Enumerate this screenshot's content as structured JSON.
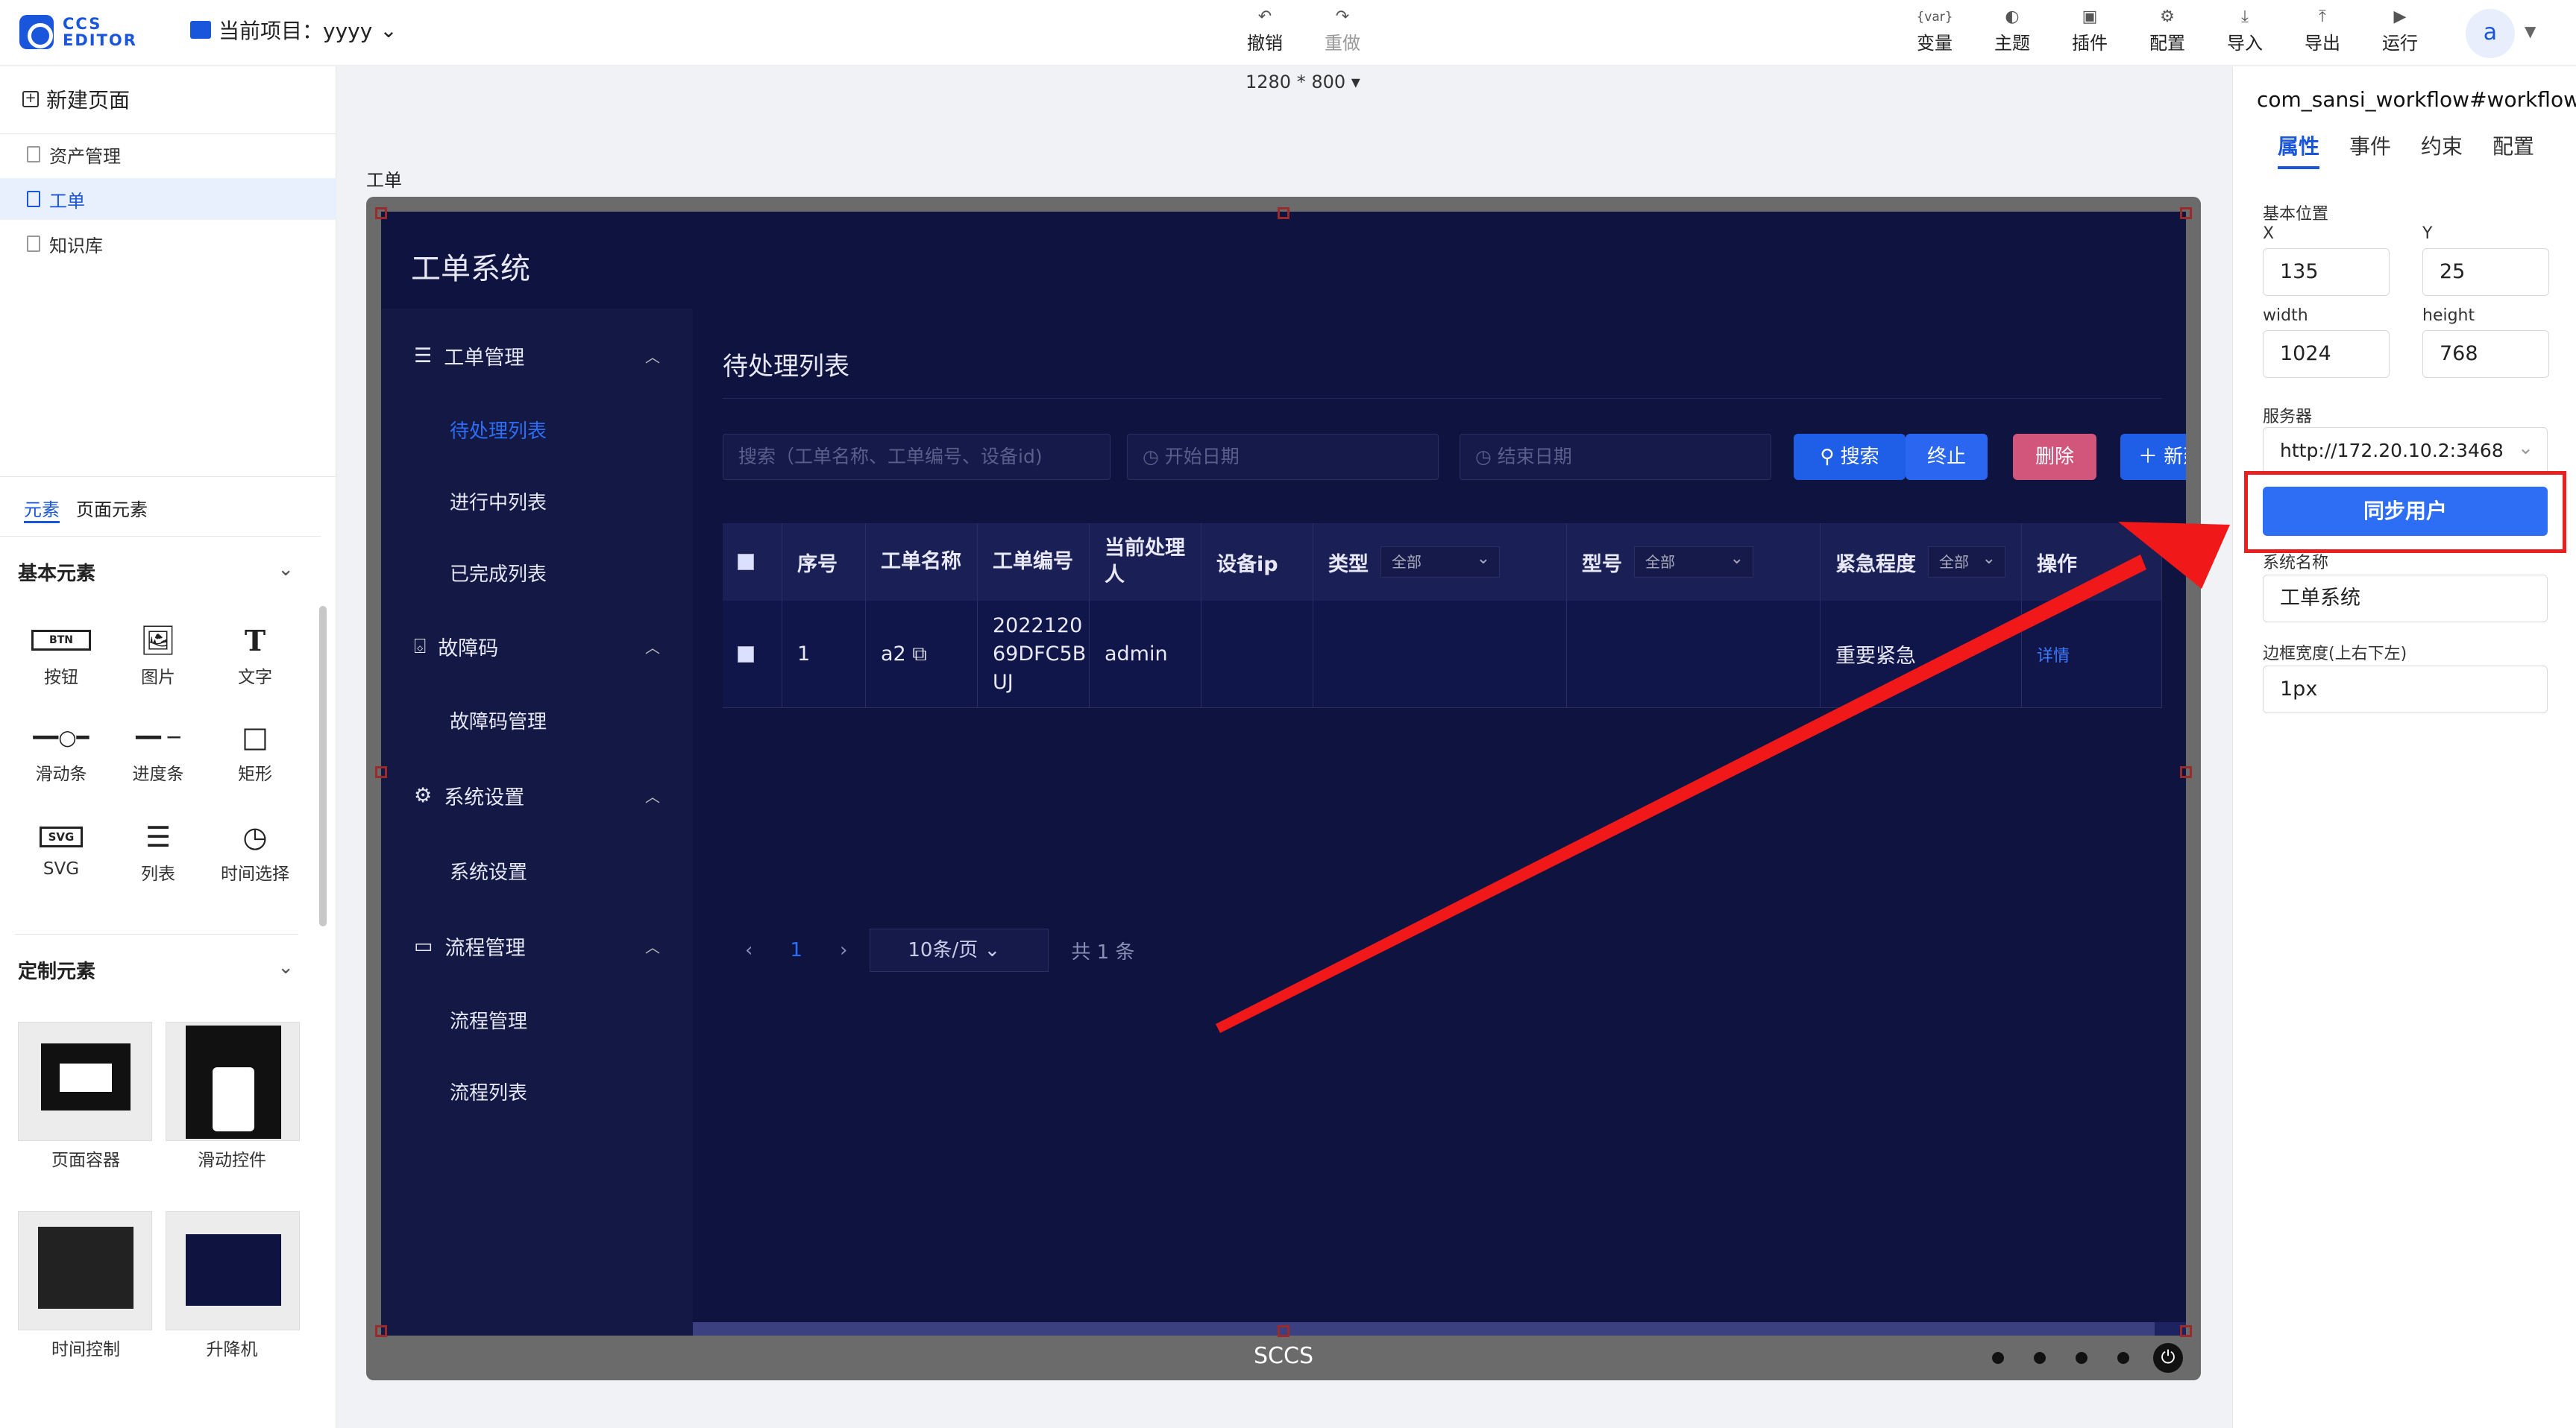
{
  "topbar": {
    "logo_line1": "CCS",
    "logo_line2": "EDITOR",
    "project_label": "当前项目：yyyy",
    "tools": [
      {
        "icon": "undo-icon",
        "label": "撤销"
      },
      {
        "icon": "redo-icon",
        "label": "重做"
      },
      {
        "icon": "variable-icon",
        "label": "变量"
      },
      {
        "icon": "theme-icon",
        "label": "主题"
      },
      {
        "icon": "plugin-icon",
        "label": "插件"
      },
      {
        "icon": "config-icon",
        "label": "配置"
      },
      {
        "icon": "import-icon",
        "label": "导入"
      },
      {
        "icon": "export-icon",
        "label": "导出"
      },
      {
        "icon": "run-icon",
        "label": "运行"
      }
    ],
    "avatar": "a"
  },
  "left": {
    "new_page": "新建页面",
    "pages": [
      "资产管理",
      "工单",
      "知识库"
    ],
    "active_page": "工单",
    "tabs": [
      "元素",
      "页面元素"
    ],
    "basic_title": "基本元素",
    "basic": [
      "按钮",
      "图片",
      "文字",
      "滑动条",
      "进度条",
      "矩形",
      "SVG",
      "列表",
      "时间选择"
    ],
    "btn_icon_text": "BTN",
    "svg_icon_text": "SVG",
    "custom_title": "定制元素",
    "custom": [
      "页面容器",
      "滑动控件",
      "时间控制",
      "升降机"
    ]
  },
  "canvas": {
    "size": "1280 * 800",
    "page_label": "工单",
    "device_label": "SCCS"
  },
  "app": {
    "title": "工单系统",
    "nav": [
      {
        "label": "工单管理",
        "icon": "menu-icon",
        "subs": [
          "待处理列表",
          "进行中列表",
          "已完成列表"
        ]
      },
      {
        "label": "故障码",
        "icon": "inbox-icon",
        "subs": [
          "故障码管理"
        ]
      },
      {
        "label": "系统设置",
        "icon": "gear-icon",
        "subs": [
          "系统设置"
        ]
      },
      {
        "label": "流程管理",
        "icon": "monitor-icon",
        "subs": [
          "流程管理",
          "流程列表"
        ]
      }
    ],
    "active_sub": "待处理列表",
    "main_title": "待处理列表",
    "search_placeholder": "搜索（工单名称、工单编号、设备id)",
    "start_date": "开始日期",
    "end_date": "结束日期",
    "btn_search": "搜索",
    "btn_stop": "终止",
    "btn_delete": "删除",
    "btn_new": "新建",
    "columns": [
      "序号",
      "工单名称",
      "工单编号",
      "当前处理人",
      "设备ip",
      "类型",
      "型号",
      "紧急程度",
      "操作"
    ],
    "filter_all": "全部",
    "rows": [
      {
        "no": "1",
        "name": "a2",
        "code": "202212069DFC5BUJ",
        "handler": "admin",
        "ip": "",
        "type": "",
        "model": "",
        "urgency": "重要紧急",
        "action": "详情"
      }
    ],
    "pager": {
      "page": "1",
      "page_size": "10条/页",
      "total": "共 1 条"
    }
  },
  "right": {
    "title": "com_sansi_workflow#workflow_",
    "tabs": [
      "属性",
      "事件",
      "约束",
      "配置"
    ],
    "basic_pos": "基本位置",
    "x_label": "X",
    "x": "135",
    "y_label": "Y",
    "y": "25",
    "w_label": "width",
    "w": "1024",
    "h_label": "height",
    "h": "768",
    "server_label": "服务器",
    "server": "http://172.20.10.2:3468",
    "sync_btn": "同步用户",
    "sys_name_label": "系统名称",
    "sys_name": "工单系统",
    "border_label": "边框宽度(上右下左)",
    "border": "1px"
  },
  "colors": {
    "accent": "#1a56db",
    "app_bg": "#0f1340",
    "annotation": "#e82020"
  }
}
